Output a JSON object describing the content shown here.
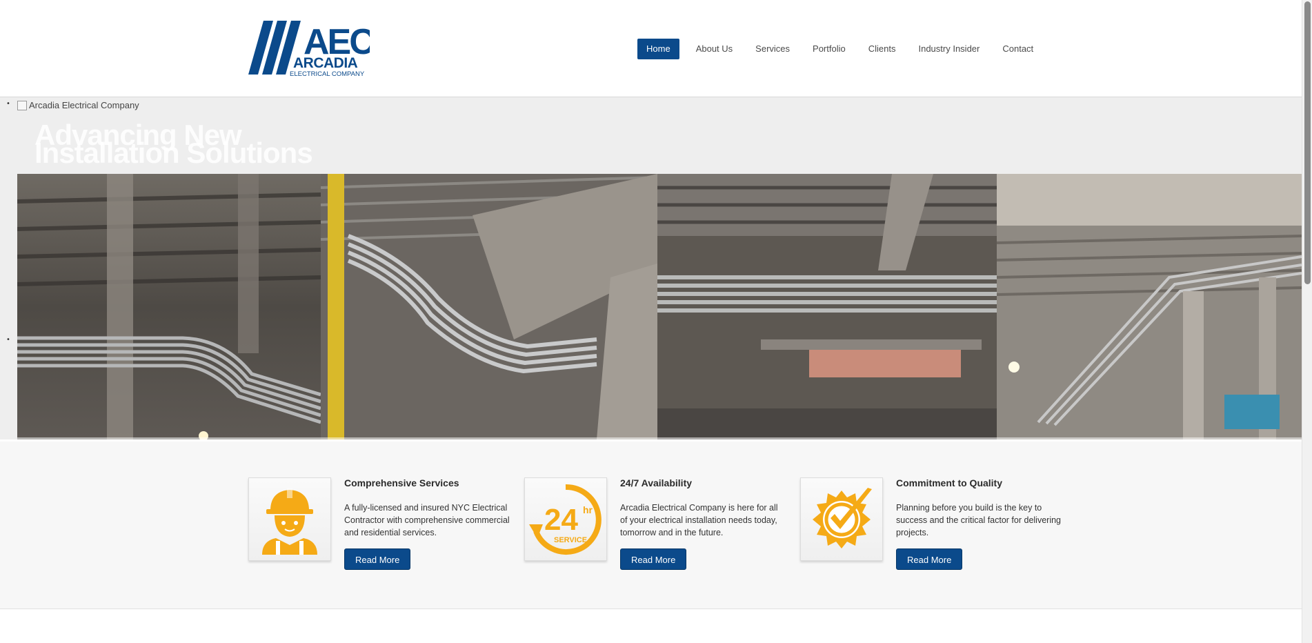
{
  "brand": {
    "logo_letters": "AEC",
    "logo_name": "ARCADIA",
    "logo_tagline": "ELECTRICAL COMPANY",
    "color": "#0b4a8b"
  },
  "nav": {
    "items": [
      "Home",
      "About Us",
      "Services",
      "Portfolio",
      "Clients",
      "Industry Insider",
      "Contact"
    ],
    "active": "Home"
  },
  "slider": {
    "broken_image_alt": "Arcadia Electrical Company",
    "title_line1": "Advancing New",
    "title_line2": "Installation Solutions",
    "bullet": "•"
  },
  "features": [
    {
      "title": "Comprehensive Services",
      "text": "A fully-licensed and insured NYC Electrical Contractor with comprehensive commercial and residential services.",
      "button": "Read More",
      "icon": "worker-icon"
    },
    {
      "title": "24/7 Availability",
      "text": "Arcadia Electrical Company is here for all of your electrical installation needs today, tomorrow and in the future.",
      "button": "Read More",
      "icon": "24hr-service-icon",
      "icon_text_main": "24",
      "icon_text_hr": "hr",
      "icon_text_service": "SERVICE"
    },
    {
      "title": "Commitment to Quality",
      "text": "Planning before you build is the key to success and the critical factor for delivering projects.",
      "button": "Read More",
      "icon": "quality-badge-icon"
    }
  ],
  "accent_color": "#f5aa16"
}
